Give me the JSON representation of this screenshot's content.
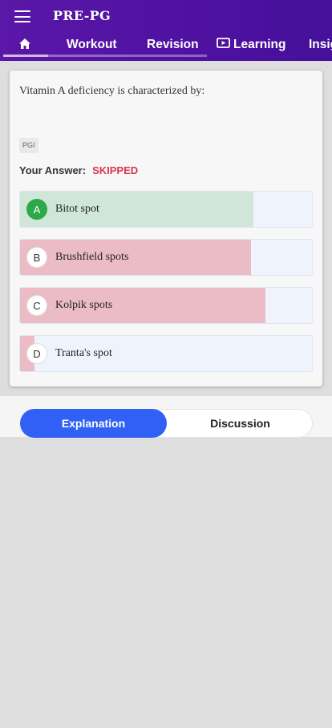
{
  "app": {
    "title": "PRE-PG"
  },
  "tabs": [
    {
      "id": "home",
      "icon": "home-icon"
    },
    {
      "id": "workout",
      "label": "Workout"
    },
    {
      "id": "revision",
      "label": "Revision"
    },
    {
      "id": "learning",
      "label": "Learning",
      "icon": "play-icon"
    },
    {
      "id": "insights",
      "label": "Insights"
    }
  ],
  "question": {
    "text": "Vitamin A deficiency is characterized by:",
    "tag": "PGI",
    "answer_label": "Your Answer:",
    "answer_value": "SKIPPED",
    "options": [
      {
        "letter": "A",
        "text": "Bitot spot",
        "status": "correct",
        "fill_percent": 80
      },
      {
        "letter": "B",
        "text": "Brushfield spots",
        "status": "wrong",
        "fill_percent": 79
      },
      {
        "letter": "C",
        "text": "Kolpik spots",
        "status": "wrong",
        "fill_percent": 84
      },
      {
        "letter": "D",
        "text": "Tranta's spot",
        "status": "wrong",
        "fill_percent": 5
      }
    ]
  },
  "switcher": {
    "explanation_label": "Explanation",
    "discussion_label": "Discussion",
    "active": "explanation"
  },
  "colors": {
    "header": "#5a17a8",
    "correct": "#2ea84a",
    "correct_fill": "#cfe6d9",
    "wrong_fill": "#ebbcc6",
    "skipped": "#d9364f",
    "accent": "#3060f5"
  }
}
